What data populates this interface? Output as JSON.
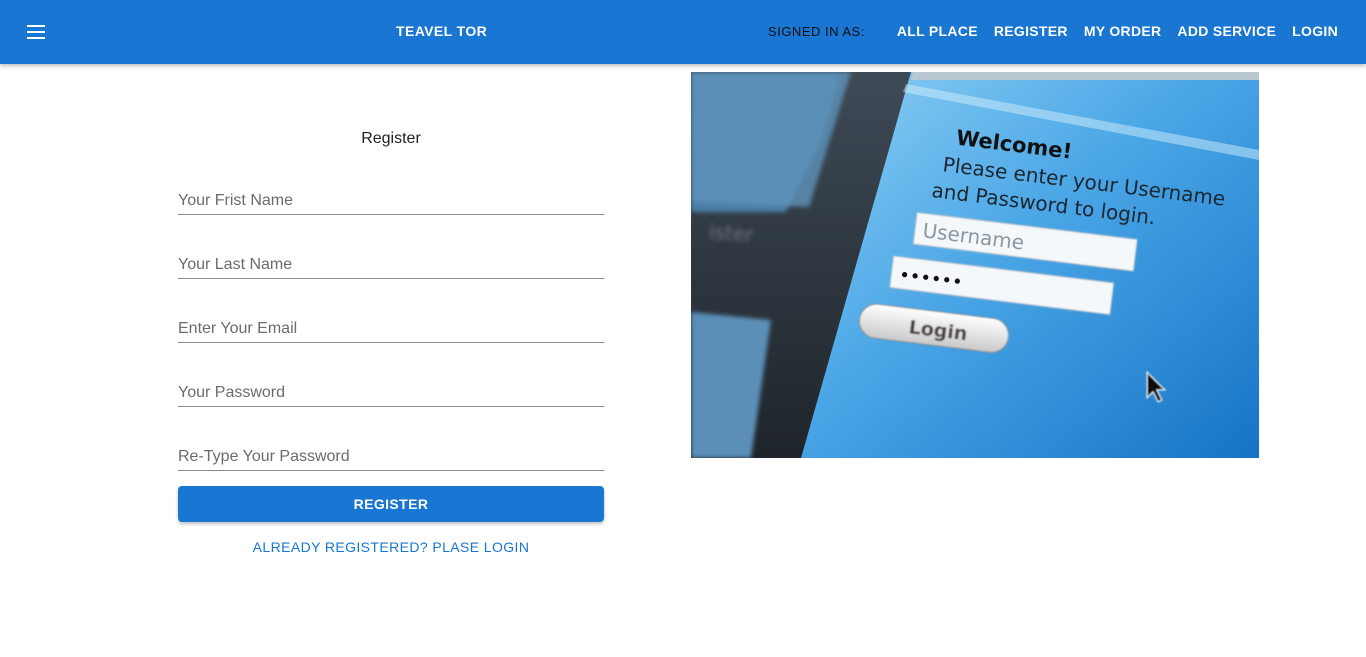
{
  "appbar": {
    "menu_icon": "hamburger-menu-icon",
    "brand": "TEAVEL TOR",
    "signed_in_label": "SIGNED IN AS:",
    "nav": [
      "ALL PLACE",
      "REGISTER",
      "MY ORDER",
      "ADD SERVICE",
      "LOGIN"
    ],
    "color": "#1976d2"
  },
  "form": {
    "title": "Register",
    "first_name_placeholder": "Your Frist Name",
    "last_name_placeholder": "Your Last Name",
    "email_placeholder": "Enter Your Email",
    "password_placeholder": "Your Password",
    "retype_password_placeholder": "Re-Type Your Password",
    "submit_label": "REGISTER",
    "login_link": "ALREADY REGISTERED? PLASE LOGIN"
  },
  "hero_image": {
    "welcome": "Welcome!",
    "line1": "Please enter your Username",
    "line2": "and Password to login.",
    "username_placeholder": "Username",
    "password_mask": "••••••",
    "login_button": "Login"
  }
}
